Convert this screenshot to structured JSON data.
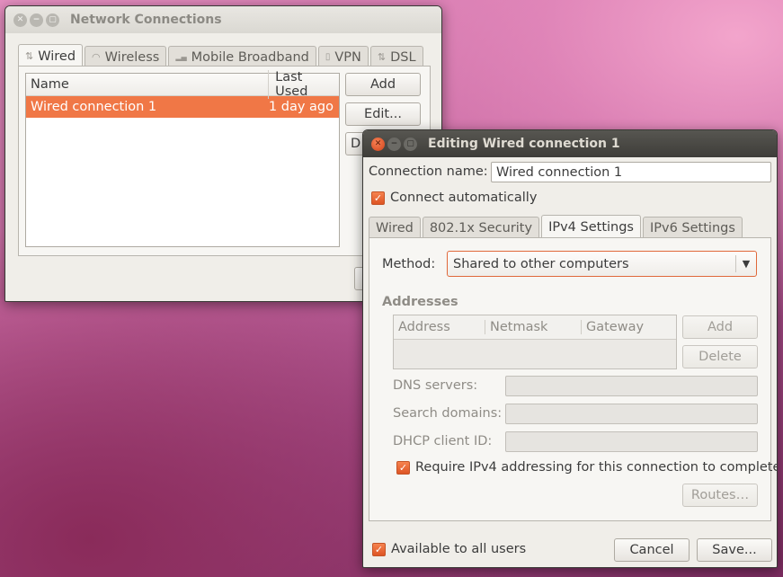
{
  "network_window": {
    "title": "Network Connections",
    "tabs": [
      {
        "label": "Wired",
        "icon": "wired-icon",
        "glyph": "⇅"
      },
      {
        "label": "Wireless",
        "icon": "wifi-icon",
        "glyph": "◠"
      },
      {
        "label": "Mobile Broadband",
        "icon": "signal-icon",
        "glyph": "▂▄"
      },
      {
        "label": "VPN",
        "icon": "lock-icon",
        "glyph": "🔒"
      },
      {
        "label": "DSL",
        "icon": "dsl-icon",
        "glyph": "⇅"
      }
    ],
    "list": {
      "columns": [
        "Name",
        "Last Used"
      ],
      "rows": [
        {
          "name": "Wired connection 1",
          "last_used": "1 day ago"
        }
      ]
    },
    "buttons": {
      "add": "Add",
      "edit": "Edit...",
      "delete_partial": "D"
    }
  },
  "edit_window": {
    "title": "Editing Wired connection 1",
    "connection_name_label": "Connection name:",
    "connection_name_value": "Wired connection 1",
    "connect_automatically": "Connect automatically",
    "tabs": [
      "Wired",
      "802.1x Security",
      "IPv4 Settings",
      "IPv6 Settings"
    ],
    "method_label": "Method:",
    "method_value": "Shared to other computers",
    "addresses_heading": "Addresses",
    "address_columns": [
      "Address",
      "Netmask",
      "Gateway"
    ],
    "addr_add": "Add",
    "addr_delete": "Delete",
    "dns_label": "DNS servers:",
    "search_label": "Search domains:",
    "dhcp_label": "DHCP client ID:",
    "require_ipv4": "Require IPv4 addressing for this connection to complete",
    "routes": "Routes…",
    "available_all": "Available to all users",
    "cancel": "Cancel",
    "save": "Save..."
  },
  "colors": {
    "accent": "#f07746",
    "selection": "#f07746"
  }
}
